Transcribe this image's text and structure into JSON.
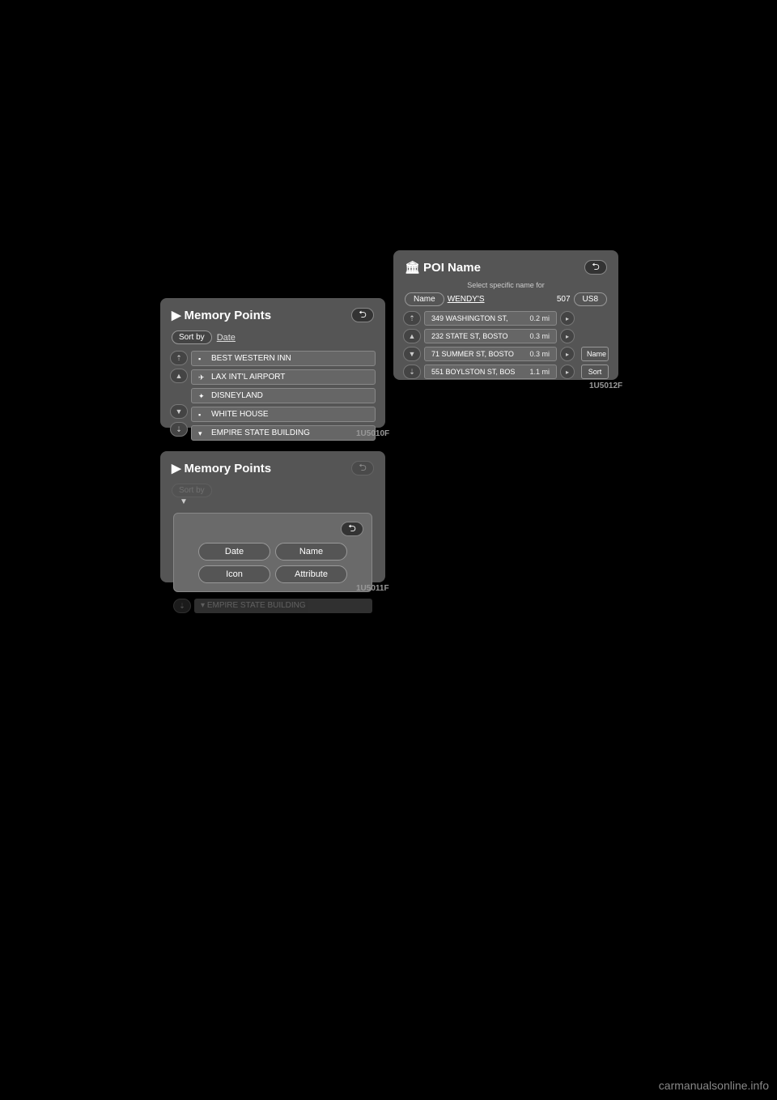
{
  "screen1": {
    "title": "Memory Points",
    "sort_by_label": "Sort by",
    "sort_value": "Date",
    "items": [
      "BEST WESTERN INN",
      "LAX INT'L AIRPORT",
      "DISNEYLAND",
      "WHITE HOUSE",
      "EMPIRE STATE BUILDING"
    ],
    "img_label": "1U5010F"
  },
  "screen2": {
    "title": "Memory Points",
    "options": {
      "date": "Date",
      "name": "Name",
      "icon": "Icon",
      "attribute": "Attribute"
    },
    "faded_item": "EMPIRE STATE BUILDING",
    "img_label": "1U5011F"
  },
  "screen3": {
    "title": "POI Name",
    "subtitle": "Select specific name for",
    "name_btn": "Name",
    "search_text": "WENDY'S",
    "result_count": "507",
    "usb_btn": "US8",
    "items": [
      {
        "addr": "349 WASHINGTON ST,",
        "dist": "0.2 mi"
      },
      {
        "addr": "232 STATE ST, BOSTO",
        "dist": "0.3 mi"
      },
      {
        "addr": "71 SUMMER ST, BOSTO",
        "dist": "0.3 mi"
      },
      {
        "addr": "551 BOYLSTON ST, BOS",
        "dist": "1.1 mi"
      }
    ],
    "side_name": "Name",
    "side_sort": "Sort",
    "img_label": "1U5012F"
  },
  "watermark": "carmanualsonline.info"
}
